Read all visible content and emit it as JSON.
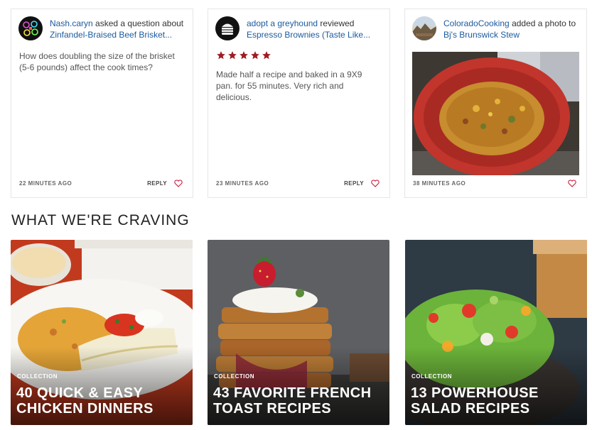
{
  "activity": [
    {
      "user": "Nash.caryn",
      "action": " asked a question about",
      "target": "Zinfandel-Braised Beef Brisket...",
      "body": "How does doubling the size of the brisket (5-6 pounds) affect the cook times?",
      "time": "22 MINUTES AGO",
      "reply": "REPLY",
      "avatar_icon": "neon-badge-avatar"
    },
    {
      "user": "adopt a greyhound",
      "action": " reviewed",
      "target": "Espresso Brownies (Taste Like...",
      "rating": 5,
      "rating_max": 5,
      "body": "Made half a recipe and baked in a 9X9 pan. for 55 minutes. Very rich and delicious.",
      "time": "23 MINUTES AGO",
      "reply": "REPLY",
      "avatar_icon": "burger-avatar",
      "star_color": "#a01c23"
    },
    {
      "user": "ColoradoCooking",
      "action": " added a photo to ",
      "target": "Bj's Brunswick Stew",
      "time": "38 MINUTES AGO",
      "avatar_icon": "landscape-avatar"
    }
  ],
  "section_title": "WHAT WE'RE CRAVING",
  "collections": [
    {
      "kicker": "COLLECTION",
      "title": "40 Quick & Easy Chicken Dinners"
    },
    {
      "kicker": "COLLECTION",
      "title": "43 Favorite French Toast Recipes"
    },
    {
      "kicker": "COLLECTION",
      "title": "13 Powerhouse Salad Recipes"
    }
  ],
  "colors": {
    "link": "#1c5a9e",
    "accent_red": "#a01c23"
  }
}
